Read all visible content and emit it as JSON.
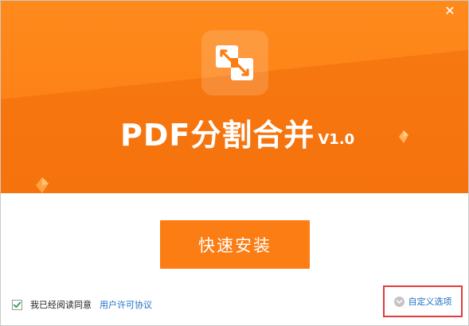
{
  "window": {
    "close_label": "✕"
  },
  "header": {
    "app_icon": "pdf-split-merge-icon",
    "title": "PDF分割合并",
    "version": "V1.0"
  },
  "install": {
    "button_label": "快速安装"
  },
  "footer": {
    "agree_checked": true,
    "agree_text": "我已经阅读同意",
    "license_link": "用户许可协议",
    "custom_options_label": "自定义选项",
    "custom_options_icon": "chevron-down-icon"
  },
  "colors": {
    "accent": "#fb7d13",
    "link": "#1f6fc5",
    "highlight_border": "#e23b3b"
  }
}
